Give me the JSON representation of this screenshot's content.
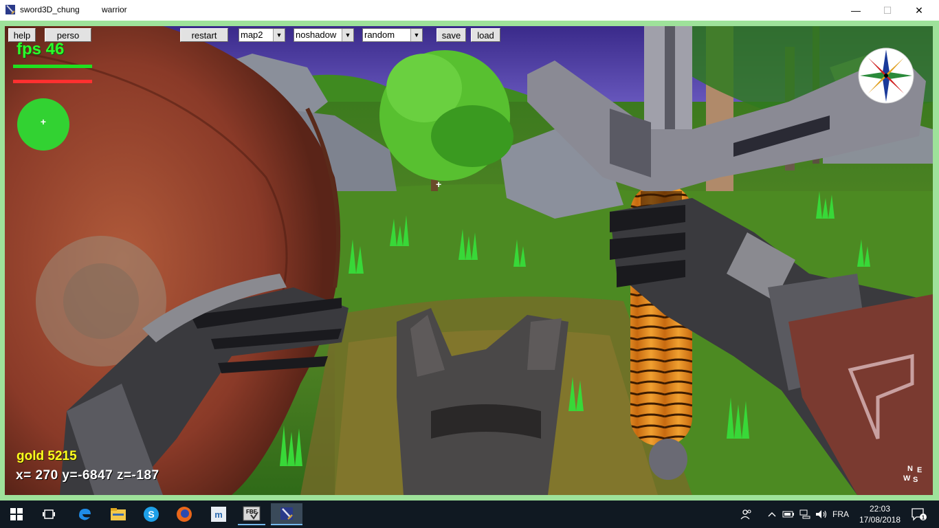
{
  "window": {
    "title": "sword3D_chung",
    "subtitle": "warrior",
    "min_glyph": "—",
    "max_glyph": "☐",
    "close_glyph": "✕"
  },
  "toolbar": {
    "help_label": "help",
    "perso_label": "perso",
    "restart_label": "restart",
    "map_value": "map2",
    "shadow_value": "noshadow",
    "mode_value": "random",
    "save_label": "save",
    "load_label": "load",
    "arrow_glyph": "▼"
  },
  "hud": {
    "fps_text": "fps 46",
    "health_color": "#20e020",
    "stamina_color": "#ff3030",
    "radar_color": "#32d232",
    "radar_glyph": "+",
    "crosshair_glyph": "+",
    "gold_text": "gold 5215",
    "coords_text": "x= 270 y=-6847 z=-187",
    "mini_compass": {
      "n": "N",
      "e": "E",
      "w": "W",
      "s": "S"
    }
  },
  "taskbar": {
    "icons": [
      "windows-start-icon",
      "task-view-icon",
      "edge-icon",
      "file-explorer-icon",
      "skype-icon",
      "firefox-icon",
      "app-m-icon",
      "fbe-app-icon",
      "sword3d-app-icon"
    ],
    "fbe_label": "FBE",
    "lang": "FRA",
    "time": "22:03",
    "date": "17/08/2018",
    "notif_count": "1"
  },
  "colors": {
    "frame": "#9ee29a",
    "taskbar": "#101922",
    "gold": "#ffff1e",
    "fps": "#2cff2c"
  }
}
